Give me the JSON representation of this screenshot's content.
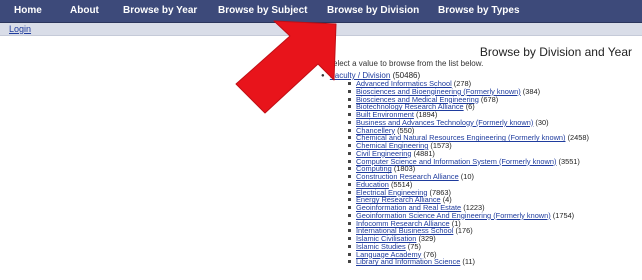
{
  "nav": {
    "items": [
      {
        "label": "Home"
      },
      {
        "label": "About"
      },
      {
        "label": "Browse by Year"
      },
      {
        "label": "Browse by Subject"
      },
      {
        "label": "Browse by Division"
      },
      {
        "label": "Browse by Types"
      }
    ]
  },
  "subbar": {
    "login": "Login"
  },
  "main": {
    "title": "Browse by Division and Year",
    "instructions": "select a value to browse from the list below.",
    "root": {
      "label": "Faculty / Division",
      "count": "(50486)"
    },
    "divisions": [
      {
        "label": "Advanced Informatics School",
        "count": "(278)"
      },
      {
        "label": "Biosciences and Bioengineering (Formerly known)",
        "count": "(384)"
      },
      {
        "label": "Biosciences and Medical Engineering",
        "count": "(678)"
      },
      {
        "label": "Biotechnology Research Alliance",
        "count": "(6)"
      },
      {
        "label": "Built Environment",
        "count": "(1894)"
      },
      {
        "label": "Business and Advances Technology (Formerly known)",
        "count": "(30)"
      },
      {
        "label": "Chancellery",
        "count": "(550)"
      },
      {
        "label": "Chemical and Natural Resources Engineering (Formerly known)",
        "count": "(2458)"
      },
      {
        "label": "Chemical Engineering",
        "count": "(1573)"
      },
      {
        "label": "Civil Engineering",
        "count": "(4881)"
      },
      {
        "label": "Computer Science and Information System (Formerly known)",
        "count": "(3551)"
      },
      {
        "label": "Computing",
        "count": "(1803)"
      },
      {
        "label": "Construction Research Alliance",
        "count": "(10)"
      },
      {
        "label": "Education",
        "count": "(5514)"
      },
      {
        "label": "Electrical Engineering",
        "count": "(7863)"
      },
      {
        "label": "Energy Research Alliance",
        "count": "(4)"
      },
      {
        "label": "Geoinformation and Real Estate",
        "count": "(1223)"
      },
      {
        "label": "Geoinformation Science And Engineering (Formerly known)",
        "count": "(1754)"
      },
      {
        "label": "Infocomm Research Alliance",
        "count": "(1)"
      },
      {
        "label": "International Business School",
        "count": "(176)"
      },
      {
        "label": "Islamic Civilisation",
        "count": "(329)"
      },
      {
        "label": "Islamic Studies",
        "count": "(75)"
      },
      {
        "label": "Language Academy",
        "count": "(76)"
      },
      {
        "label": "Library and Information Science",
        "count": "(11)"
      }
    ]
  },
  "colors": {
    "nav_bg": "#3d4a7a",
    "link": "#1f3c9e",
    "arrow": "#e8141b"
  },
  "annotation": {
    "icon": "red-arrow-icon"
  }
}
